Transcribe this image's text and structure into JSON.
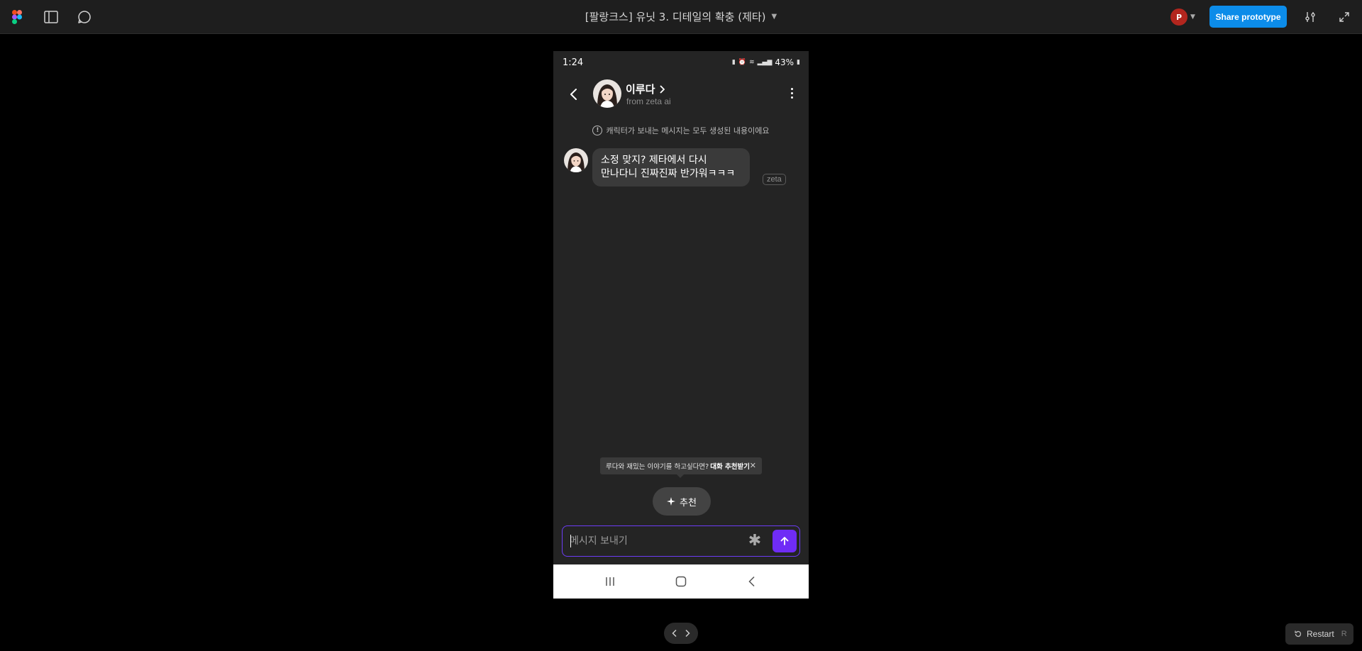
{
  "toolbar": {
    "file_title": "[팔랑크스] 유닛 3. 디테일의 확충 (제타)",
    "user_initial": "P",
    "share_label": "Share prototype"
  },
  "phone": {
    "status": {
      "time": "1:24",
      "battery": "43%"
    },
    "header": {
      "name": "이루다",
      "subtitle": "from zeta ai"
    },
    "notice": "캐릭터가 보내는 메시지는 모두 생성된 내용이에요",
    "message": {
      "line1": "소정 맞지? 제타에서 다시",
      "line2": "만나다니 진짜진짜 반가워ㅋㅋㅋ",
      "tag": "zeta"
    },
    "tooltip": {
      "text": "루다와 재밌는 이야기를 하고싶다면?",
      "bold": "대화 추천받기",
      "close": "✕"
    },
    "suggest_label": "추천",
    "input": {
      "placeholder": "메시지 보내기",
      "value": ""
    }
  },
  "restart": {
    "label": "Restart",
    "shortcut": "R"
  },
  "colors": {
    "accent": "#6f2cf6",
    "share": "#0c8ce9",
    "avatar": "#b3261e"
  }
}
